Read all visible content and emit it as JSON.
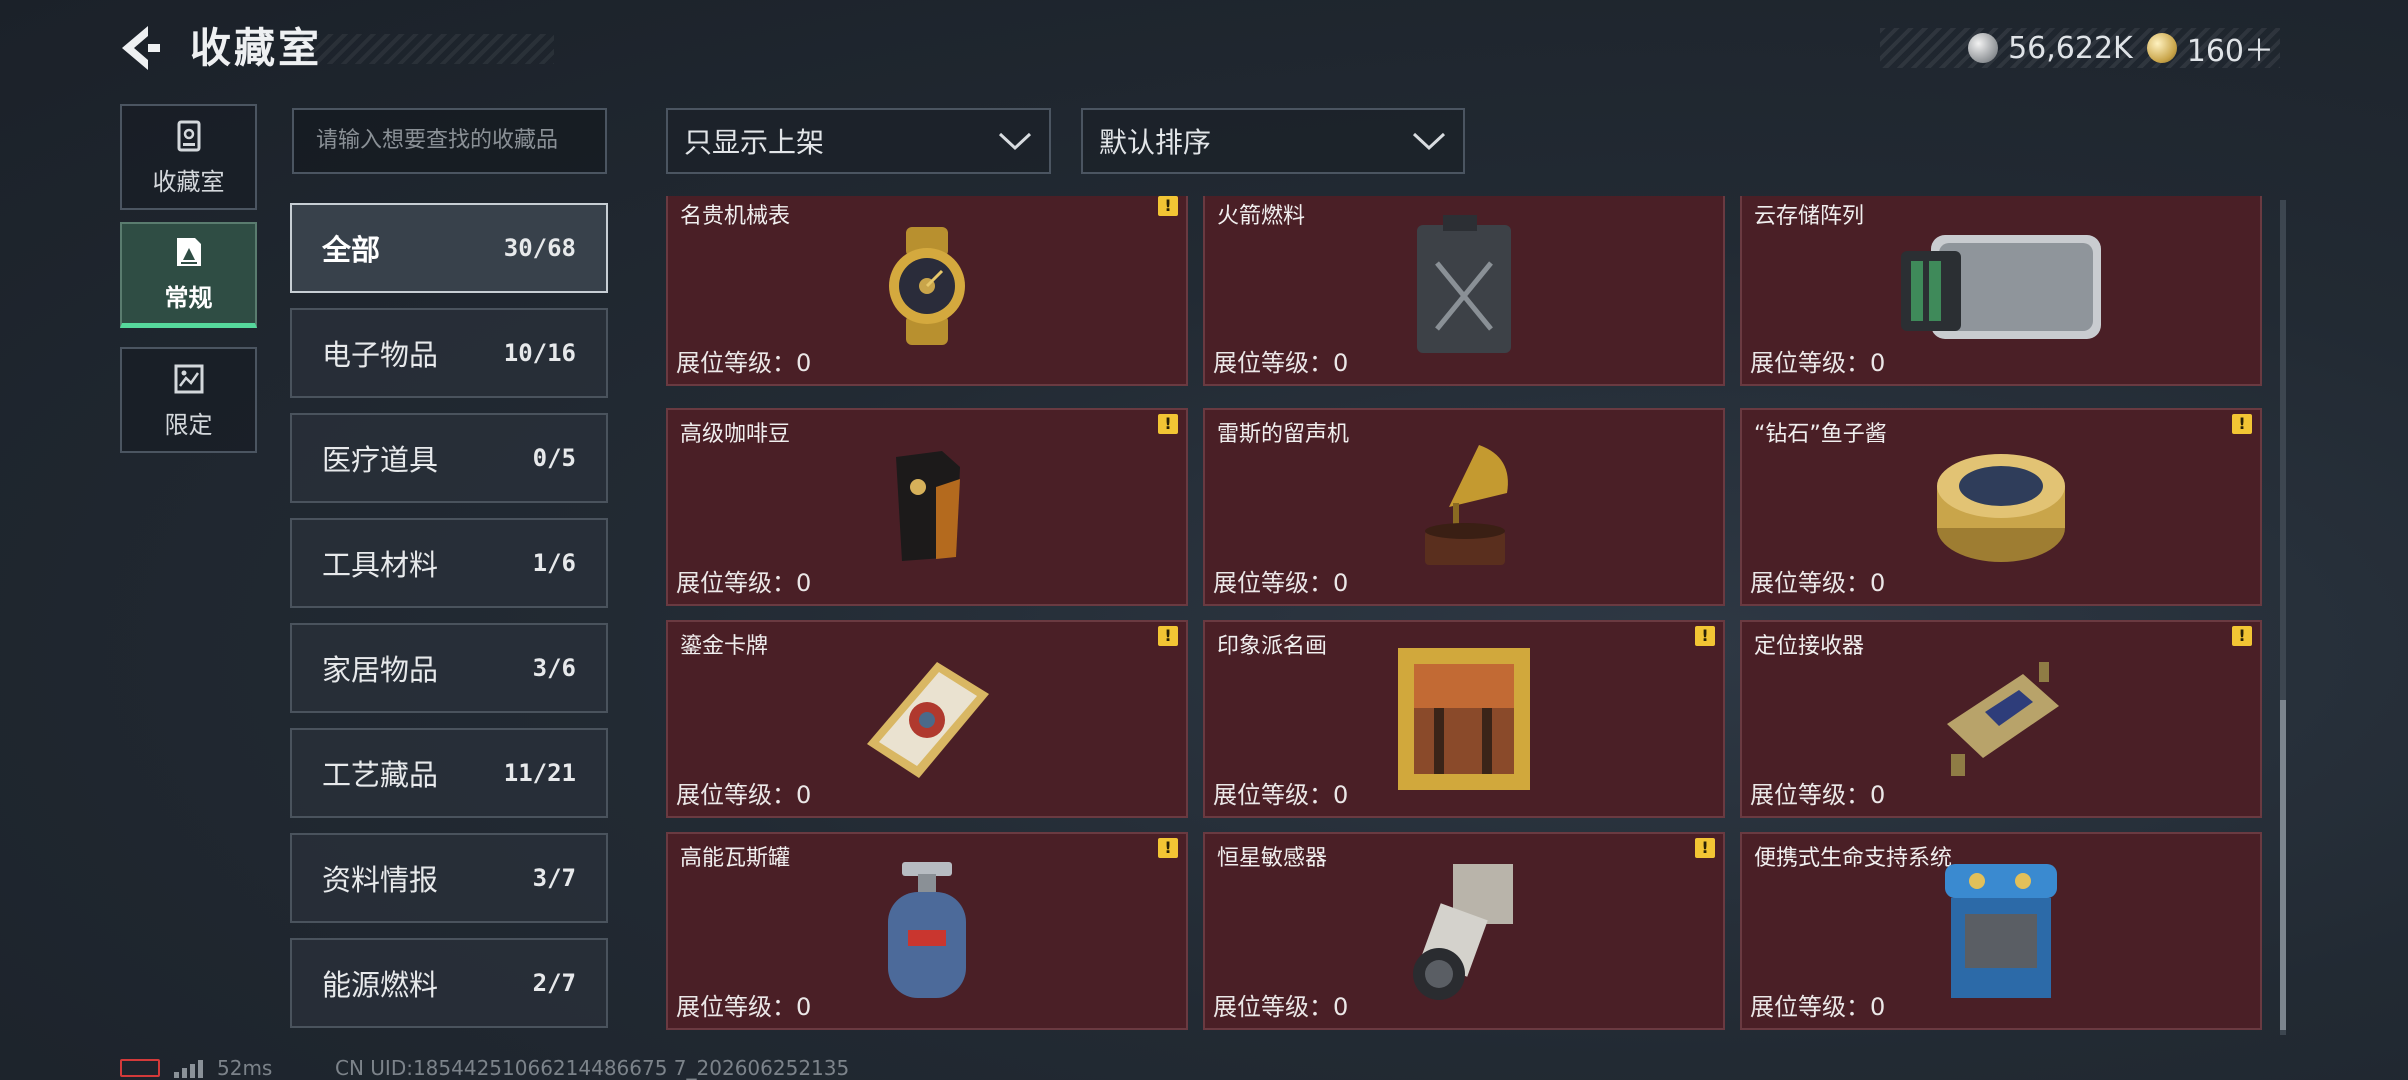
{
  "header": {
    "title": "收藏室",
    "currency": [
      {
        "icon": "silver-coin-icon",
        "value": "56,622K"
      },
      {
        "icon": "gold-coin-icon",
        "value": "160＋"
      }
    ]
  },
  "rail": [
    {
      "label": "收藏室",
      "icon": "collection-room-icon"
    },
    {
      "label": "常规",
      "icon": "regular-icon",
      "active": true
    },
    {
      "label": "限定",
      "icon": "limited-icon"
    }
  ],
  "search": {
    "placeholder": "请输入想要查找的收藏品"
  },
  "categories": [
    {
      "name": "全部",
      "count": "30/68",
      "active": true
    },
    {
      "name": "电子物品",
      "count": "10/16"
    },
    {
      "name": "医疗道具",
      "count": "0/5"
    },
    {
      "name": "工具材料",
      "count": "1/6"
    },
    {
      "name": "家居物品",
      "count": "3/6"
    },
    {
      "name": "工艺藏品",
      "count": "11/21"
    },
    {
      "name": "资料情报",
      "count": "3/7"
    },
    {
      "name": "能源燃料",
      "count": "2/7"
    }
  ],
  "filters": {
    "display": "只显示上架",
    "sort": "默认排序"
  },
  "level_label": "展位等级：0",
  "items": [
    {
      "name": "名贵机械表",
      "warn": true,
      "icon": "watch-icon"
    },
    {
      "name": "火箭燃料",
      "warn": false,
      "icon": "fuel-can-icon"
    },
    {
      "name": "云存储阵列",
      "warn": false,
      "icon": "storage-array-icon"
    },
    {
      "name": "高级咖啡豆",
      "warn": true,
      "icon": "coffee-bag-icon"
    },
    {
      "name": "雷斯的留声机",
      "warn": false,
      "icon": "gramophone-icon"
    },
    {
      "name": "“钻石”鱼子酱",
      "warn": true,
      "icon": "caviar-tin-icon"
    },
    {
      "name": "鎏金卡牌",
      "warn": true,
      "icon": "gilded-card-icon"
    },
    {
      "name": "印象派名画",
      "warn": true,
      "icon": "painting-icon"
    },
    {
      "name": "定位接收器",
      "warn": true,
      "icon": "receiver-icon"
    },
    {
      "name": "高能瓦斯罐",
      "warn": true,
      "icon": "gas-canister-icon"
    },
    {
      "name": "恒星敏感器",
      "warn": true,
      "icon": "star-sensor-icon"
    },
    {
      "name": "便携式生命支持系统",
      "warn": false,
      "icon": "life-support-icon"
    }
  ],
  "warn_symbol": "!",
  "status": {
    "ping": "52ms",
    "uid": "CN UID:18544251066214486675 7_202606252135"
  }
}
